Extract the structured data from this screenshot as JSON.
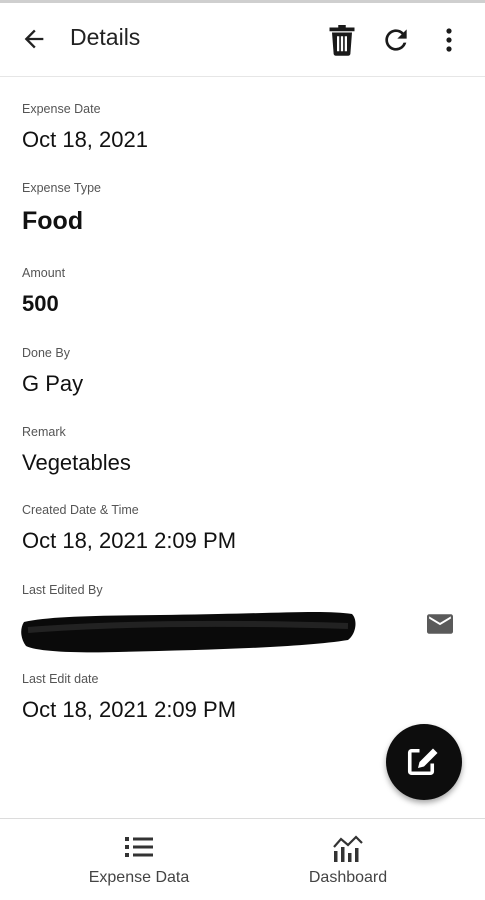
{
  "app_bar": {
    "title": "Details",
    "icons": [
      "arrow-back-icon",
      "delete-icon",
      "refresh-icon",
      "more-vert-icon"
    ]
  },
  "fields": {
    "expense_date": {
      "label": "Expense Date",
      "value": "Oct 18, 2021"
    },
    "expense_type": {
      "label": "Expense Type",
      "value": "Food"
    },
    "amount": {
      "label": "Amount",
      "value": "500"
    },
    "done_by": {
      "label": "Done By",
      "value": "G Pay"
    },
    "remark": {
      "label": "Remark",
      "value": "Vegetables"
    },
    "created": {
      "label": "Created Date & Time",
      "value": "Oct 18, 2021 2:09 PM"
    },
    "last_edited_by": {
      "label": "Last Edited By",
      "value_redacted": true,
      "action_icon": "mail-icon"
    },
    "last_edit_date": {
      "label": "Last Edit date",
      "value": "Oct 18, 2021 2:09 PM"
    }
  },
  "fab": {
    "icon": "edit-icon"
  },
  "bottom_nav": {
    "items": [
      {
        "label": "Expense Data",
        "icon": "list-icon"
      },
      {
        "label": "Dashboard",
        "icon": "analytics-icon"
      }
    ]
  },
  "colors": {
    "fab_background": "#0d0d0d",
    "text_primary": "#111111",
    "label_text": "#555555"
  }
}
